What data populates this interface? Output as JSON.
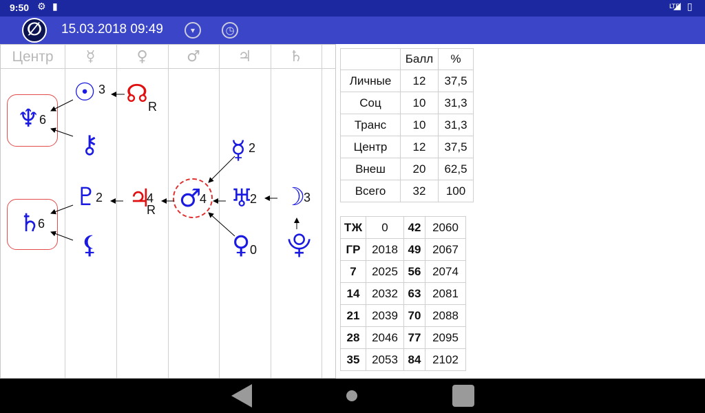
{
  "status": {
    "time": "9:50",
    "network": "LTE"
  },
  "app": {
    "logo": "∅",
    "datetime": "15.03.2018 09:49",
    "dropdown_icon": "▾",
    "clock_icon": "◷"
  },
  "chart": {
    "columns": [
      "Центр",
      "☿",
      "♀",
      "♂",
      "♃",
      "♄"
    ],
    "planets": {
      "neptune": {
        "glyph": "♆",
        "value": "6"
      },
      "sun": {
        "glyph": "☉",
        "value": "3"
      },
      "node": {
        "glyph": "☊",
        "retro": "R"
      },
      "chiron": {
        "glyph": "⚷"
      },
      "mercury": {
        "glyph": "☿",
        "value": "2"
      },
      "pluto": {
        "glyph": "♇",
        "value": "2"
      },
      "jupiter": {
        "glyph": "♃",
        "value": "4",
        "retro": "R"
      },
      "mars": {
        "glyph": "♂",
        "value": "4"
      },
      "uranus": {
        "glyph": "♅",
        "value": "2"
      },
      "moon": {
        "glyph": "☽",
        "value": "3"
      },
      "saturn": {
        "glyph": "♄",
        "value": "6"
      },
      "lilith": {
        "glyph": "⚸"
      },
      "venus": {
        "glyph": "♀",
        "value": "0"
      },
      "proserpina": {
        "glyph": "⯓"
      }
    }
  },
  "stats": {
    "header": [
      "",
      "Балл",
      "%"
    ],
    "rows": [
      [
        "Личные",
        "12",
        "37,5"
      ],
      [
        "Соц",
        "10",
        "31,3"
      ],
      [
        "Транс",
        "10",
        "31,3"
      ],
      [
        "Центр",
        "12",
        "37,5"
      ],
      [
        "Внеш",
        "20",
        "62,5"
      ],
      [
        "Всего",
        "32",
        "100"
      ]
    ]
  },
  "years": {
    "rows": [
      [
        "ТЖ",
        "0",
        "42",
        "2060"
      ],
      [
        "ГР",
        "2018",
        "49",
        "2067"
      ],
      [
        "7",
        "2025",
        "56",
        "2074"
      ],
      [
        "14",
        "2032",
        "63",
        "2081"
      ],
      [
        "21",
        "2039",
        "70",
        "2088"
      ],
      [
        "28",
        "2046",
        "77",
        "2095"
      ],
      [
        "35",
        "2053",
        "84",
        "2102"
      ]
    ]
  },
  "colors": {
    "status_bar": "#1c28a0",
    "app_bar": "#3a46c7",
    "planet_blue": "#1a1ae0",
    "planet_red": "#e01010",
    "highlight": "#e34b4b"
  }
}
